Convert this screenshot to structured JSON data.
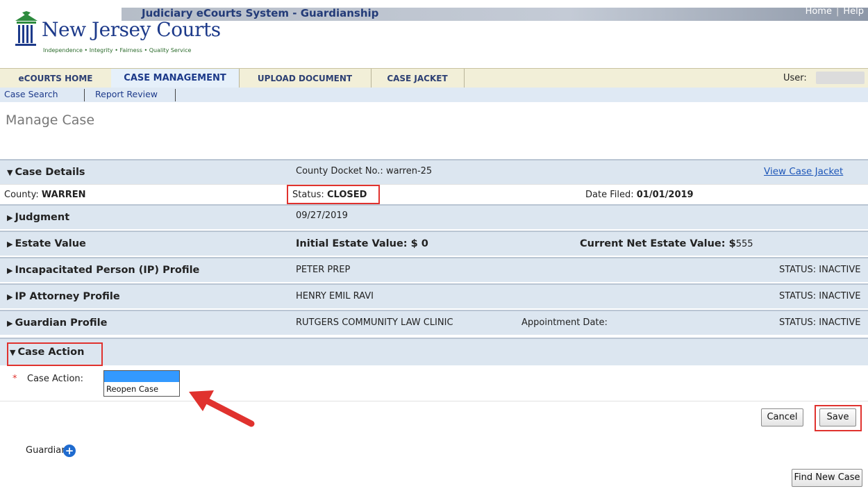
{
  "header": {
    "system_name": "Judiciary eCourts System - Guardianship",
    "links": [
      "Home",
      "Help"
    ],
    "brand": "New Jersey Courts",
    "tagline": "Independence • Integrity • Fairness • Quality Service"
  },
  "nav": {
    "tabs": [
      "eCOURTS HOME",
      "CASE MANAGEMENT",
      "UPLOAD DOCUMENT",
      "CASE JACKET"
    ],
    "selected": "CASE MANAGEMENT",
    "user_label": "User:",
    "subnav": [
      "Case Search",
      "Report Review"
    ]
  },
  "page_title": "Manage Case",
  "case_details": {
    "label": "Case Details",
    "docket_label": "County Docket No.:",
    "docket_value": "warren-25",
    "view_jacket": "View Case Jacket",
    "county_label": "County:",
    "county_value": "WARREN",
    "status_label": "Status:",
    "status_value": "CLOSED",
    "date_filed_label": "Date Filed:",
    "date_filed_value": "01/01/2019"
  },
  "judgment": {
    "label": "Judgment",
    "date": "09/27/2019"
  },
  "estate": {
    "label": "Estate Value",
    "initial": "Initial Estate Value: $ 0",
    "current_label": "Current Net Estate Value: $",
    "current_value": "555"
  },
  "ip_profile": {
    "label": "Incapacitated Person (IP) Profile",
    "name": "PETER PREP",
    "status": "STATUS: INACTIVE"
  },
  "ip_attorney": {
    "label": "IP Attorney Profile",
    "name": "HENRY EMIL RAVI",
    "status": "STATUS: INACTIVE"
  },
  "guardian_profile": {
    "label": "Guardian Profile",
    "name": "RUTGERS COMMUNITY LAW CLINIC",
    "appointment_label": "Appointment Date:",
    "status": "STATUS: INACTIVE"
  },
  "case_action": {
    "label": "Case Action",
    "required_mark": "*",
    "field_label": "Case Action:",
    "selected_option": "",
    "options": [
      "Reopen Case"
    ]
  },
  "buttons": {
    "cancel": "Cancel",
    "save": "Save",
    "find_new_case": "Find New Case"
  },
  "guardian_label": "Guardian",
  "colors": {
    "highlight": "#e0322e",
    "row_bg": "#dce6f0",
    "link": "#1d56b8",
    "selected_option": "#3399ff"
  }
}
